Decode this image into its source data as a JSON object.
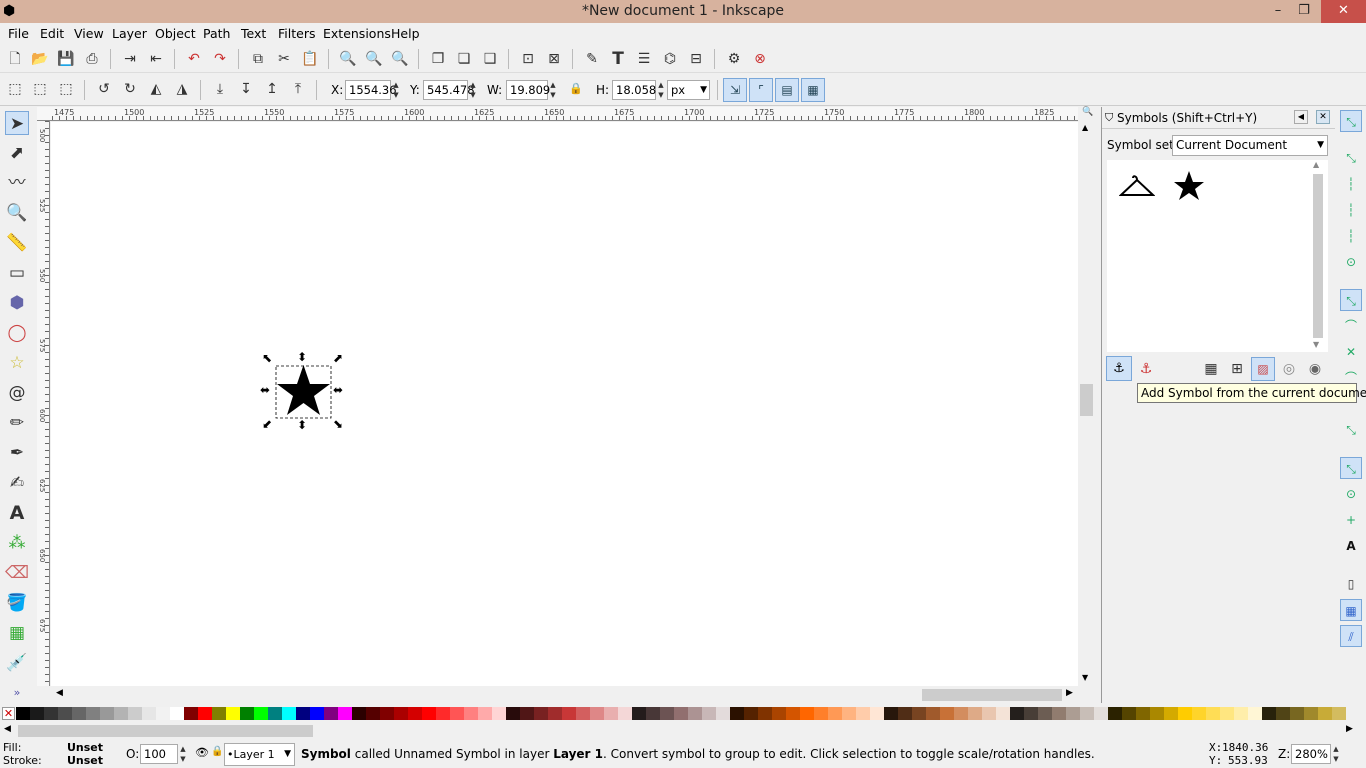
{
  "window": {
    "title": "*New document 1 - Inkscape",
    "minimize": "–",
    "maximize": "❐",
    "close": "✕"
  },
  "menus": [
    "File",
    "Edit",
    "View",
    "Layer",
    "Object",
    "Path",
    "Text",
    "Filters",
    "Extensions",
    "Help"
  ],
  "select_toolbar": {
    "x_label": "X:",
    "x_value": "1554.36",
    "y_label": "Y:",
    "y_value": "545.478",
    "w_label": "W:",
    "w_value": "19.809",
    "h_label": "H:",
    "h_value": "18.058",
    "unit": "px"
  },
  "ruler": {
    "h_ticks": [
      "1475",
      "1500",
      "1525",
      "1550",
      "1575",
      "1600",
      "1625",
      "1650",
      "1675",
      "1700",
      "1725",
      "1750",
      "1775",
      "1800",
      "1825"
    ],
    "v_ticks": [
      "500",
      "525",
      "550",
      "575",
      "600",
      "625",
      "650",
      "675"
    ]
  },
  "symbols_dialog": {
    "title": "Symbols (Shift+Ctrl+Y)",
    "symbol_set_label": "Symbol set:",
    "symbol_set_value": "Current Document",
    "symbols": [
      "hanger-icon",
      "star-icon"
    ],
    "tooltip": "Add Symbol from the current document."
  },
  "palette": {
    "colors": [
      "#000000",
      "#1a1a1a",
      "#333333",
      "#4d4d4d",
      "#666666",
      "#808080",
      "#999999",
      "#b3b3b3",
      "#cccccc",
      "#e6e6e6",
      "#f2f2f2",
      "#ffffff",
      "#800000",
      "#ff0000",
      "#808000",
      "#ffff00",
      "#008000",
      "#00ff00",
      "#008080",
      "#00ffff",
      "#000080",
      "#0000ff",
      "#800080",
      "#ff00ff",
      "#2b0000",
      "#550000",
      "#800000",
      "#aa0000",
      "#d40000",
      "#ff0000",
      "#ff2a2a",
      "#ff5555",
      "#ff8080",
      "#ffaaaa",
      "#ffd5d5",
      "#280b0b",
      "#501616",
      "#782121",
      "#a02c2c",
      "#c83737",
      "#d35f5f",
      "#de8787",
      "#e9afaf",
      "#f4d7d7",
      "#241c1c",
      "#483737",
      "#6c5353",
      "#916f6f",
      "#ac9393",
      "#c8b7b7",
      "#e3dbdb",
      "#2b1100",
      "#552200",
      "#803300",
      "#aa4400",
      "#d45500",
      "#ff6600",
      "#ff7f2a",
      "#ff9955",
      "#ffb380",
      "#ffccaa",
      "#ffe6d5",
      "#28170b",
      "#502d16",
      "#784421",
      "#a05a2c",
      "#c87137",
      "#d38d5f",
      "#deaa87",
      "#e9c6af",
      "#f4e3d7",
      "#241f1c",
      "#483e37",
      "#6c5d53",
      "#917c6f",
      "#ac9d93",
      "#c8beb7",
      "#e3dedb",
      "#2b2200",
      "#554400",
      "#806600",
      "#aa8800",
      "#d4aa00",
      "#ffcc00",
      "#ffd42a",
      "#ffdd55",
      "#ffe680",
      "#ffeeaa",
      "#fff6d5",
      "#28220b",
      "#504416",
      "#786721",
      "#a0892c",
      "#c8ab37",
      "#d3bc5f"
    ]
  },
  "status": {
    "fill_label": "Fill:",
    "fill_value": "Unset",
    "stroke_label": "Stroke:",
    "stroke_value": "Unset",
    "opacity_label": "O:",
    "opacity_value": "100",
    "layer": "•Layer 1",
    "message_bold": "Symbol",
    "message_1": " called Unnamed Symbol in layer ",
    "message_layer": "Layer 1",
    "message_2": ". Convert symbol to group to edit. Click selection to toggle scale/rotation handles.",
    "cursor_x_label": "X:",
    "cursor_x": "1840.36",
    "cursor_y_label": "Y:",
    "cursor_y": "553.93",
    "zoom_label": "Z:",
    "zoom": "280%"
  }
}
